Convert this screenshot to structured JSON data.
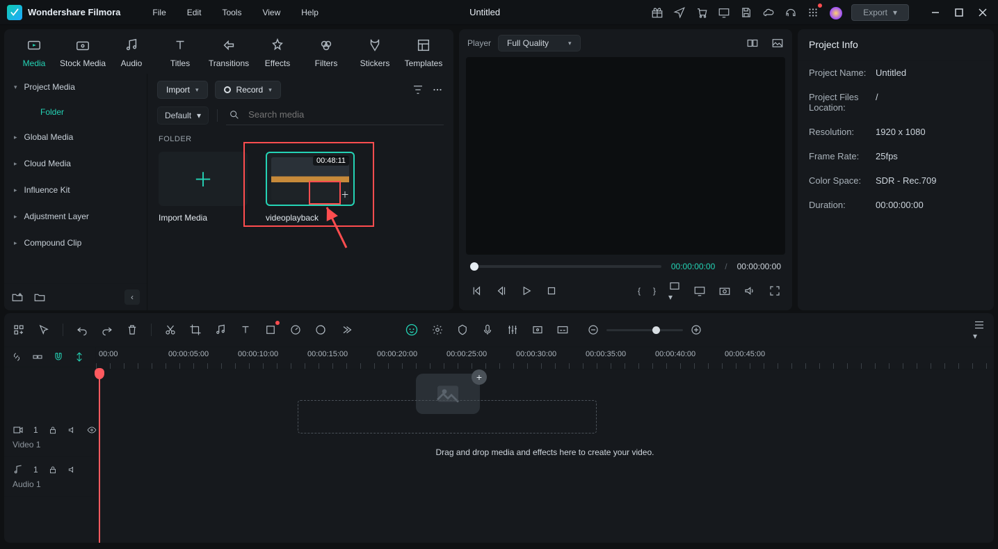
{
  "app": {
    "title": "Wondershare Filmora",
    "doc_title": "Untitled",
    "export": "Export"
  },
  "menus": [
    "File",
    "Edit",
    "Tools",
    "View",
    "Help"
  ],
  "top_tabs": [
    {
      "label": "Media",
      "active": true
    },
    {
      "label": "Stock Media"
    },
    {
      "label": "Audio"
    },
    {
      "label": "Titles"
    },
    {
      "label": "Transitions"
    },
    {
      "label": "Effects"
    },
    {
      "label": "Filters"
    },
    {
      "label": "Stickers"
    },
    {
      "label": "Templates"
    }
  ],
  "side_tree": {
    "project_media": "Project Media",
    "folder": "Folder",
    "global_media": "Global Media",
    "cloud_media": "Cloud Media",
    "influence_kit": "Influence Kit",
    "adjustment_layer": "Adjustment Layer",
    "compound_clip": "Compound Clip"
  },
  "media_toolbar": {
    "import": "Import",
    "record": "Record",
    "sort_default": "Default",
    "search_placeholder": "Search media"
  },
  "folder_label": "FOLDER",
  "thumbs": {
    "import_media": "Import Media",
    "clip_name": "videoplayback",
    "clip_duration": "00:48:11"
  },
  "player": {
    "label": "Player",
    "quality": "Full Quality",
    "time_current": "00:00:00:00",
    "time_total": "00:00:00:00"
  },
  "info": {
    "header": "Project Info",
    "rows": {
      "project_name_k": "Project Name:",
      "project_name_v": "Untitled",
      "files_loc_k": "Project Files Location:",
      "files_loc_v": "/",
      "resolution_k": "Resolution:",
      "resolution_v": "1920 x 1080",
      "frame_rate_k": "Frame Rate:",
      "frame_rate_v": "25fps",
      "color_space_k": "Color Space:",
      "color_space_v": "SDR - Rec.709",
      "duration_k": "Duration:",
      "duration_v": "00:00:00:00"
    }
  },
  "timeline": {
    "dnd_text": "Drag and drop media and effects here to create your video.",
    "ruler": [
      "00:00",
      "00:00:05:00",
      "00:00:10:00",
      "00:00:15:00",
      "00:00:20:00",
      "00:00:25:00",
      "00:00:30:00",
      "00:00:35:00",
      "00:00:40:00",
      "00:00:45:00"
    ],
    "tracks": {
      "video_num": "1",
      "video_label": "Video 1",
      "audio_num": "1",
      "audio_label": "Audio 1"
    }
  }
}
